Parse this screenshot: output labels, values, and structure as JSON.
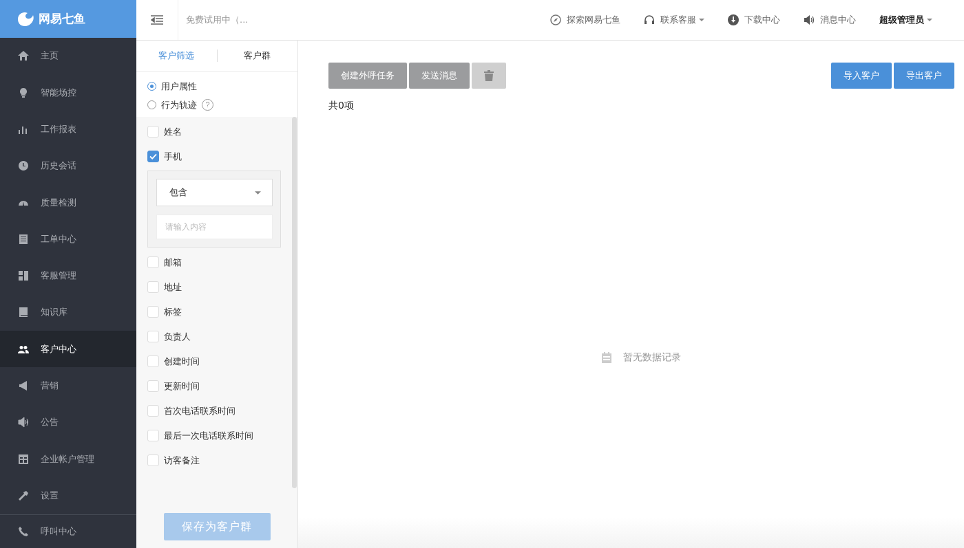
{
  "logo": {
    "text": "网易七鱼"
  },
  "header": {
    "trial": "免费试用中（...",
    "nav": [
      {
        "label": "探索网易七鱼",
        "dropdown": false
      },
      {
        "label": "联系客服",
        "dropdown": true
      },
      {
        "label": "下载中心",
        "dropdown": false
      },
      {
        "label": "消息中心",
        "dropdown": false
      }
    ],
    "user": {
      "label": "超级管理员",
      "dropdown": true
    }
  },
  "sidebar": {
    "items": [
      {
        "label": "主页",
        "selected": false
      },
      {
        "label": "智能场控",
        "selected": false
      },
      {
        "label": "工作报表",
        "selected": false
      },
      {
        "label": "历史会话",
        "selected": false
      },
      {
        "label": "质量检测",
        "selected": false
      },
      {
        "label": "工单中心",
        "selected": false
      },
      {
        "label": "客服管理",
        "selected": false
      },
      {
        "label": "知识库",
        "selected": false
      },
      {
        "label": "客户中心",
        "selected": true
      },
      {
        "label": "营销",
        "selected": false
      },
      {
        "label": "公告",
        "selected": false
      },
      {
        "label": "企业帐户管理",
        "selected": false
      },
      {
        "label": "设置",
        "selected": false
      }
    ],
    "footer_item": {
      "label": "呼叫中心",
      "selected": false
    }
  },
  "filter": {
    "tabs": [
      {
        "label": "客户筛选",
        "selected": true
      },
      {
        "label": "客户群",
        "selected": false
      }
    ],
    "modes": [
      {
        "label": "用户属性",
        "selected": true
      },
      {
        "label": "行为轨迹",
        "selected": false,
        "help": "?"
      }
    ],
    "fields": [
      {
        "label": "姓名",
        "checked": false
      },
      {
        "label": "手机",
        "checked": true,
        "condition": {
          "operator": "包含",
          "placeholder": "请输入内容"
        }
      },
      {
        "label": "邮箱",
        "checked": false
      },
      {
        "label": "地址",
        "checked": false
      },
      {
        "label": "标签",
        "checked": false
      },
      {
        "label": "负责人",
        "checked": false
      },
      {
        "label": "创建时间",
        "checked": false
      },
      {
        "label": "更新时间",
        "checked": false
      },
      {
        "label": "首次电话联系时间",
        "checked": false
      },
      {
        "label": "最后一次电话联系时间",
        "checked": false
      },
      {
        "label": "访客备注",
        "checked": false
      }
    ],
    "save_button": {
      "label": "保存为客户群",
      "disabled": true
    }
  },
  "toolbar": {
    "left": [
      {
        "kind": "text",
        "label": "创建外呼任务",
        "disabled": true
      },
      {
        "kind": "text",
        "label": "发送消息",
        "disabled": true
      },
      {
        "kind": "delete",
        "disabled": true
      }
    ],
    "right": [
      {
        "kind": "text",
        "label": "导入客户",
        "disabled": false
      },
      {
        "kind": "text",
        "label": "导出客户",
        "disabled": false
      }
    ]
  },
  "count": "共0项",
  "empty": "暂无数据记录"
}
